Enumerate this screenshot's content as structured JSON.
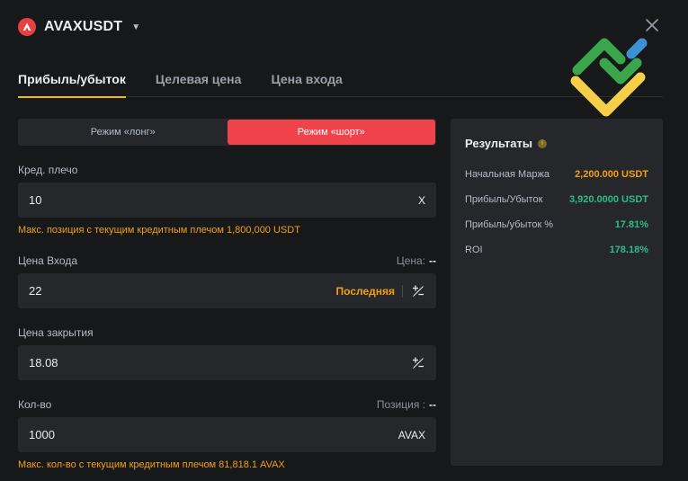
{
  "header": {
    "symbol": "AVAXUSDT",
    "icon": "avax-logo-icon",
    "caret": "▼",
    "close_icon": "close-icon"
  },
  "tabs": [
    {
      "label": "Прибыль/убыток",
      "active": true
    },
    {
      "label": "Целевая цена",
      "active": false
    },
    {
      "label": "Цена входа",
      "active": false
    }
  ],
  "mode": {
    "long_label": "Режим «лонг»",
    "short_label": "Режим «шорт»",
    "selected": "short"
  },
  "leverage": {
    "label": "Кред. плечо",
    "value": "10",
    "suffix": "X",
    "hint": "Макс. позиция с текущим кредитным плечом 1,800,000 USDT"
  },
  "entry_price": {
    "label": "Цена Входа",
    "aux_label": "Цена:",
    "aux_value": "--",
    "value": "22",
    "latest_label": "Последняя"
  },
  "close_price": {
    "label": "Цена закрытия",
    "value": "18.08"
  },
  "quantity": {
    "label": "Кол-во",
    "aux_label": "Позиция :",
    "aux_value": "--",
    "value": "1000",
    "suffix": "AVAX",
    "hint": "Макс. кол-во с текущим кредитным плечом 81,818.1 AVAX"
  },
  "results": {
    "title": "Результаты",
    "info_icon": "i",
    "rows": [
      {
        "label": "Начальная Маржа",
        "value": "2,200.000 USDT",
        "color": "#f0a017"
      },
      {
        "label": "Прибыль/Убыток",
        "value": "3,920.0000 USDT",
        "color": "#2ebd85"
      },
      {
        "label": "Прибыль/убыток %",
        "value": "17.81%",
        "color": "#2ebd85"
      },
      {
        "label": "ROI",
        "value": "178.18%",
        "color": "#2ebd85"
      }
    ]
  },
  "colors": {
    "accent_yellow": "#f0b90b",
    "short_red": "#f0424b",
    "profit_green": "#2ebd85",
    "warning_orange": "#f0a017"
  }
}
